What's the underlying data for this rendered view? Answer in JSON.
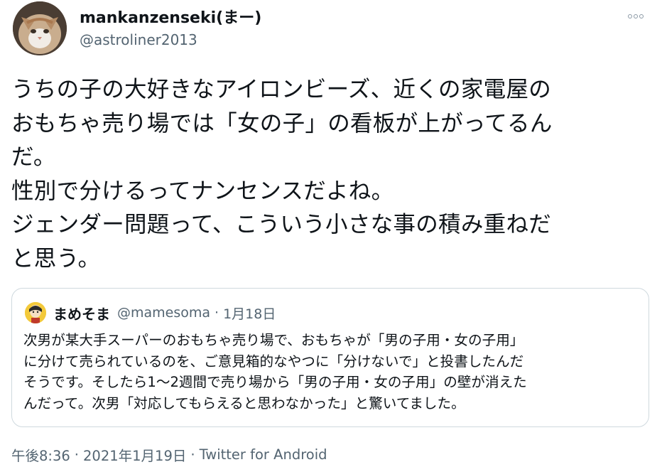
{
  "author": {
    "display_name": "mankanzenseki(まー)",
    "handle": "@astroliner2013",
    "avatar_icon": "cat-avatar-icon"
  },
  "more_icon": "more-dots-icon",
  "tweet": {
    "lines": [
      "うちの子の大好きなアイロンビーズ、近くの家電屋の",
      "おもちゃ売り場では「女の子」の看板が上がってるん",
      "だ。",
      "性別で分けるってナンセンスだよね。",
      "ジェンダー問題って、こういう小さな事の積み重ねだ",
      "と思う。"
    ]
  },
  "quoted_tweet": {
    "display_name": "まめそま",
    "handle": "@mamesoma",
    "separator": "·",
    "date": "1月18日",
    "avatar_icon": "character-avatar-icon",
    "lines": [
      "次男が某大手スーパーのおもちゃ売り場で、おもちゃが「男の子用・女の子用」",
      "に分けて売られているのを、ご意見箱的なやつに「分けないで」と投書したんだ",
      "そうです。そしたら1〜2週間で売り場から「男の子用・女の子用」の壁が消えた",
      "んだって。次男「対応してもらえると思わなかった」と驚いてました。"
    ]
  },
  "meta": {
    "time": "午後8:36",
    "separator": "·",
    "date": "2021年1月19日",
    "source": "Twitter for Android"
  },
  "colors": {
    "text": "#0f1419",
    "secondary": "#536471",
    "border": "#cfd9de"
  }
}
